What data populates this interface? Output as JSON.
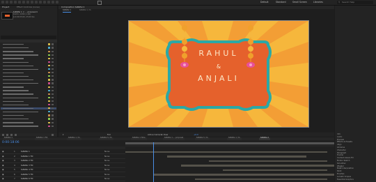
{
  "topbar": {
    "workspaces": [
      "Default",
      "Standard",
      "Small Screen",
      "Libraries"
    ],
    "search_placeholder": "Search Help"
  },
  "project": {
    "tabs": [
      "Project",
      "Effect Controls (none)"
    ],
    "header_title": "taPaPai 1 × ... proposal ▾",
    "header_line2": "1920 x 1080 (1.00)",
    "header_line3": "Δ 0:00:05:00, 25.00 fps",
    "items_count": 24
  },
  "viewer": {
    "tab_label": "Composition taPaPai 1",
    "breadcrumbs": [
      "taPaPai 1",
      "taPaPai 1 ∕ fs"
    ],
    "toolbar": {
      "zoom": "Full",
      "camera": "Active Camera",
      "views": "1 View",
      "exposure": "+0.0"
    },
    "canvas": {
      "name_line1": "RAHUL",
      "name_line2": "&",
      "name_line3": "ANJALI",
      "colors": {
        "background": "#f6b73c",
        "rays": "#f3a33a",
        "frame": "#e5612c",
        "frame_border": "#2ba8a6",
        "lantern": "#f0a02c",
        "flower": "#e8509a"
      }
    }
  },
  "timeline": {
    "timecode": "0:00:18:06",
    "tabs": [
      "taPaPai 1",
      "taPaPai 1 Fill",
      "taPaPai 1 ∕ fs",
      "taPaPai 5 ∕ fs",
      "taPaPai 1 Hole",
      "taPaPai 1 ... proposal",
      "taPaPai 5 ∕ fs",
      "taPaPai 1 ∕ fs",
      "taPaPai 2"
    ],
    "layers": [
      {
        "num": "1",
        "name": "taPaPai 1",
        "mode": "None"
      },
      {
        "num": "2",
        "name": "taPaPai 1 Fill",
        "mode": "None"
      },
      {
        "num": "3",
        "name": "taPaPai 2 Fill",
        "mode": "None"
      },
      {
        "num": "4",
        "name": "taPaPai 3 Fill",
        "mode": "None"
      },
      {
        "num": "5",
        "name": "taPaPai 4 Fill",
        "mode": "None"
      },
      {
        "num": "6",
        "name": "taPaPai 5 Fill",
        "mode": "None"
      },
      {
        "num": "7",
        "name": "taPaPai 6 Fill",
        "mode": "None"
      }
    ]
  },
  "right_panel": {
    "items": [
      "Info",
      "Audio",
      "Preview",
      "Effects & Presets",
      "Align",
      "Libraries",
      "Character",
      "Paragraph",
      "Tracker",
      "Content-Aware Fill",
      "Motion Sketch",
      "Smoother",
      "Wiggler",
      "Mask Interpolation",
      "Paint",
      "Brushes",
      "Lumetri Scopes",
      "Essential Graphics"
    ]
  }
}
